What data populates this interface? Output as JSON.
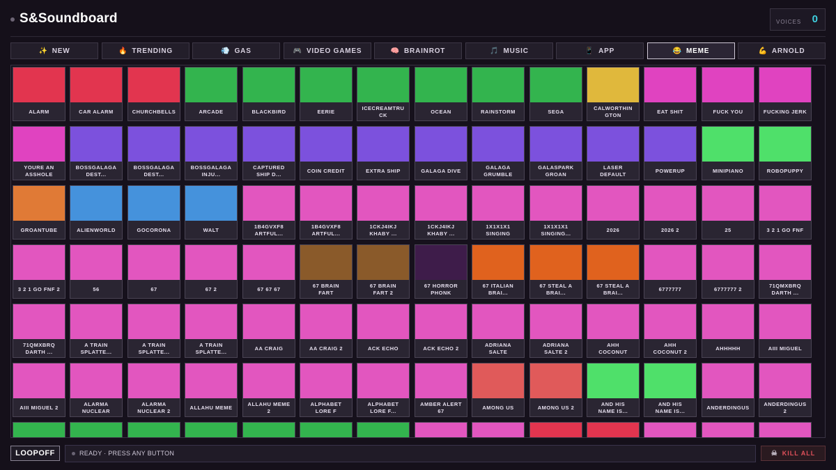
{
  "app": {
    "title": "S&Soundboard"
  },
  "voices": {
    "label": "VOICES",
    "count": "0"
  },
  "tabs": [
    {
      "icon": "✨",
      "label": "NEW"
    },
    {
      "icon": "🔥",
      "label": "TRENDING"
    },
    {
      "icon": "💨",
      "label": "GAS"
    },
    {
      "icon": "🎮",
      "label": "VIDEO GAMES"
    },
    {
      "icon": "🧠",
      "label": "BRAINROT"
    },
    {
      "icon": "🎵",
      "label": "MUSIC"
    },
    {
      "icon": "📱",
      "label": "APP"
    },
    {
      "icon": "😂",
      "label": "MEME",
      "active": true
    },
    {
      "icon": "💪",
      "label": "ARNOLD"
    }
  ],
  "colors": {
    "red": "#e2354f",
    "green": "#33b44e",
    "gold": "#e0b83c",
    "magenta": "#e043c0",
    "purple": "#7c51dd",
    "lime": "#4fe06a",
    "orange": "#e07a36",
    "blue": "#4592dc",
    "pink": "#e256bf",
    "brown": "#8a5a2a",
    "darkpurple": "#3e1c4a",
    "deeporange": "#e0621e",
    "salmon": "#e05a5a"
  },
  "pads": [
    {
      "label": "ALARM",
      "color": "#e2354f"
    },
    {
      "label": "CAR ALARM",
      "color": "#e2354f"
    },
    {
      "label": "CHURCHBELLS",
      "color": "#e2354f"
    },
    {
      "label": "ARCADE",
      "color": "#33b44e"
    },
    {
      "label": "BLACKBIRD",
      "color": "#33b44e"
    },
    {
      "label": "EERIE",
      "color": "#33b44e"
    },
    {
      "label": "ICECREAMTRU\nCK",
      "color": "#33b44e"
    },
    {
      "label": "OCEAN",
      "color": "#33b44e"
    },
    {
      "label": "RAINSTORM",
      "color": "#33b44e"
    },
    {
      "label": "SEGA",
      "color": "#33b44e"
    },
    {
      "label": "CALWORTHIN\nGTON",
      "color": "#e0b83c"
    },
    {
      "label": "EAT SHIT",
      "color": "#e043c0"
    },
    {
      "label": "FUCK YOU",
      "color": "#e043c0"
    },
    {
      "label": "FUCKING JERK",
      "color": "#e043c0"
    },
    {
      "label": "YOURE AN\nASSHOLE",
      "color": "#e043c0"
    },
    {
      "label": "BOSSGALAGA\nDEST...",
      "color": "#7c51dd"
    },
    {
      "label": "BOSSGALAGA\nDEST...",
      "color": "#7c51dd"
    },
    {
      "label": "BOSSGALAGA\nINJU...",
      "color": "#7c51dd"
    },
    {
      "label": "CAPTURED\nSHIP D...",
      "color": "#7c51dd"
    },
    {
      "label": "COIN CREDIT",
      "color": "#7c51dd"
    },
    {
      "label": "EXTRA SHIP",
      "color": "#7c51dd"
    },
    {
      "label": "GALAGA DIVE",
      "color": "#7c51dd"
    },
    {
      "label": "GALAGA\nGRUMBLE",
      "color": "#7c51dd"
    },
    {
      "label": "GALASPARK\nGROAN",
      "color": "#7c51dd"
    },
    {
      "label": "LASER\nDEFAULT",
      "color": "#7c51dd"
    },
    {
      "label": "POWERUP",
      "color": "#7c51dd"
    },
    {
      "label": "MINIPIANO",
      "color": "#4fe06a"
    },
    {
      "label": "ROBOPUPPY",
      "color": "#4fe06a"
    },
    {
      "label": "GROANTUBE",
      "color": "#e07a36"
    },
    {
      "label": "ALIENWORLD",
      "color": "#4592dc"
    },
    {
      "label": "GOCORONA",
      "color": "#4592dc"
    },
    {
      "label": "WALT",
      "color": "#4592dc"
    },
    {
      "label": "1B4GVXF8\nARTFUL...",
      "color": "#e256bf"
    },
    {
      "label": "1B4GVXF8\nARTFUL...",
      "color": "#e256bf"
    },
    {
      "label": "1CKJ4IKJ\nKHABY ...",
      "color": "#e256bf"
    },
    {
      "label": "1CKJ4IKJ\nKHABY ...",
      "color": "#e256bf"
    },
    {
      "label": "1X1X1X1\nSINGING",
      "color": "#e256bf"
    },
    {
      "label": "1X1X1X1\nSINGING...",
      "color": "#e256bf"
    },
    {
      "label": "2026",
      "color": "#e256bf"
    },
    {
      "label": "2026 2",
      "color": "#e256bf"
    },
    {
      "label": "25",
      "color": "#e256bf"
    },
    {
      "label": "3 2 1 GO FNF",
      "color": "#e256bf"
    },
    {
      "label": "3 2 1 GO FNF 2",
      "color": "#e256bf"
    },
    {
      "label": "56",
      "color": "#e256bf"
    },
    {
      "label": "67",
      "color": "#e256bf"
    },
    {
      "label": "67 2",
      "color": "#e256bf"
    },
    {
      "label": "67 67 67",
      "color": "#e256bf"
    },
    {
      "label": "67 BRAIN\nFART",
      "color": "#8a5a2a"
    },
    {
      "label": "67 BRAIN\nFART 2",
      "color": "#8a5a2a"
    },
    {
      "label": "67 HORROR\nPHONK",
      "color": "#3e1c4a"
    },
    {
      "label": "67 ITALIAN\nBRAI...",
      "color": "#e0621e"
    },
    {
      "label": "67 STEAL A\nBRAI...",
      "color": "#e0621e"
    },
    {
      "label": "67 STEAL A\nBRAI...",
      "color": "#e0621e"
    },
    {
      "label": "6777777",
      "color": "#e256bf"
    },
    {
      "label": "6777777 2",
      "color": "#e256bf"
    },
    {
      "label": "71QMXBRQ\nDARTH ...",
      "color": "#e256bf"
    },
    {
      "label": "71QMXBRQ\nDARTH ...",
      "color": "#e256bf"
    },
    {
      "label": "A TRAIN\nSPLATTE...",
      "color": "#e256bf"
    },
    {
      "label": "A TRAIN\nSPLATTE...",
      "color": "#e256bf"
    },
    {
      "label": "A TRAIN\nSPLATTE...",
      "color": "#e256bf"
    },
    {
      "label": "AA CRAIG",
      "color": "#e256bf"
    },
    {
      "label": "AA CRAIG 2",
      "color": "#e256bf"
    },
    {
      "label": "ACK ECHO",
      "color": "#e256bf"
    },
    {
      "label": "ACK ECHO 2",
      "color": "#e256bf"
    },
    {
      "label": "ADRIANA\nSALTE",
      "color": "#e256bf"
    },
    {
      "label": "ADRIANA\nSALTE 2",
      "color": "#e256bf"
    },
    {
      "label": "AHH\nCOCONUT",
      "color": "#e256bf"
    },
    {
      "label": "AHH\nCOCONUT 2",
      "color": "#e256bf"
    },
    {
      "label": "AHHHHH",
      "color": "#e256bf"
    },
    {
      "label": "AIII MIGUEL",
      "color": "#e256bf"
    },
    {
      "label": "AIII MIGUEL 2",
      "color": "#e256bf"
    },
    {
      "label": "ALARMA\nNUCLEAR",
      "color": "#e256bf"
    },
    {
      "label": "ALARMA\nNUCLEAR 2",
      "color": "#e256bf"
    },
    {
      "label": "ALLAHU MEME",
      "color": "#e256bf"
    },
    {
      "label": "ALLAHU MEME\n2",
      "color": "#e256bf"
    },
    {
      "label": "ALPHABET\nLORE F",
      "color": "#e256bf"
    },
    {
      "label": "ALPHABET\nLORE F...",
      "color": "#e256bf"
    },
    {
      "label": "AMBER ALERT\n67",
      "color": "#e256bf"
    },
    {
      "label": "AMONG US",
      "color": "#e05a5a"
    },
    {
      "label": "AMONG US 2",
      "color": "#e05a5a"
    },
    {
      "label": "AND HIS\nNAME IS...",
      "color": "#4fe06a"
    },
    {
      "label": "AND HIS\nNAME IS...",
      "color": "#4fe06a"
    },
    {
      "label": "ANDERDINGUS",
      "color": "#e256bf"
    },
    {
      "label": "ANDERDINGUS\n2",
      "color": "#e256bf"
    },
    {
      "label": "",
      "color": "#33b44e"
    },
    {
      "label": "",
      "color": "#33b44e"
    },
    {
      "label": "",
      "color": "#33b44e"
    },
    {
      "label": "",
      "color": "#33b44e"
    },
    {
      "label": "",
      "color": "#33b44e"
    },
    {
      "label": "",
      "color": "#33b44e"
    },
    {
      "label": "",
      "color": "#33b44e"
    },
    {
      "label": "",
      "color": "#e256bf"
    },
    {
      "label": "",
      "color": "#e256bf"
    },
    {
      "label": "",
      "color": "#e2354f"
    },
    {
      "label": "",
      "color": "#e2354f"
    },
    {
      "label": "",
      "color": "#e256bf"
    },
    {
      "label": "",
      "color": "#e256bf"
    },
    {
      "label": "",
      "color": "#e256bf"
    }
  ],
  "footer": {
    "loop_label": "LOOPOFF",
    "status_text": "READY · PRESS ANY BUTTON",
    "kill_icon": "☠",
    "kill_label": "KILL ALL"
  }
}
